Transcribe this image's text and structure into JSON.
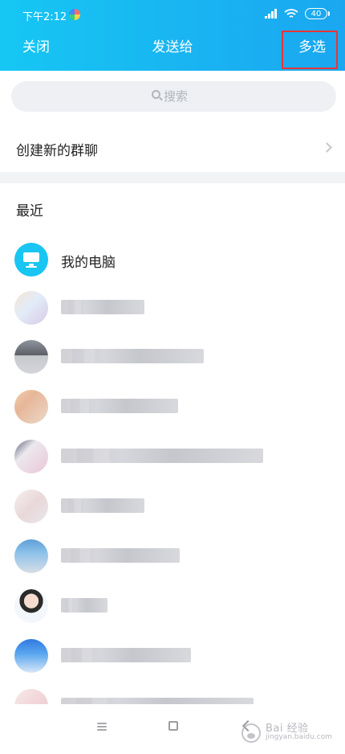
{
  "status_bar": {
    "time": "下午2:12",
    "battery": "40"
  },
  "header": {
    "left_action": "关闭",
    "title": "发送给",
    "right_action": "多选"
  },
  "search": {
    "placeholder": "搜索"
  },
  "menu": {
    "create_group": "创建新的群聊"
  },
  "recent": {
    "title": "最近",
    "items": [
      {
        "name": "我的电脑"
      },
      {
        "name": ""
      },
      {
        "name": ""
      },
      {
        "name": ""
      },
      {
        "name": ""
      },
      {
        "name": ""
      },
      {
        "name": ""
      },
      {
        "name": ""
      },
      {
        "name": ""
      },
      {
        "name": ""
      }
    ]
  },
  "watermark": {
    "main": "Bai 经验",
    "sub": "jingyan.baidu.com"
  },
  "icons": {
    "signal": "signal-icon",
    "wifi": "wifi-icon",
    "battery": "battery-icon",
    "search": "search-icon",
    "computer": "computer-icon",
    "chevron": "chevron-right-icon",
    "menu": "menu-icon",
    "home": "square-icon",
    "back": "back-icon"
  },
  "colors": {
    "primary": "#19b4f2",
    "highlight": "#e83535",
    "text": "#222222",
    "muted": "#b1b5bb"
  }
}
